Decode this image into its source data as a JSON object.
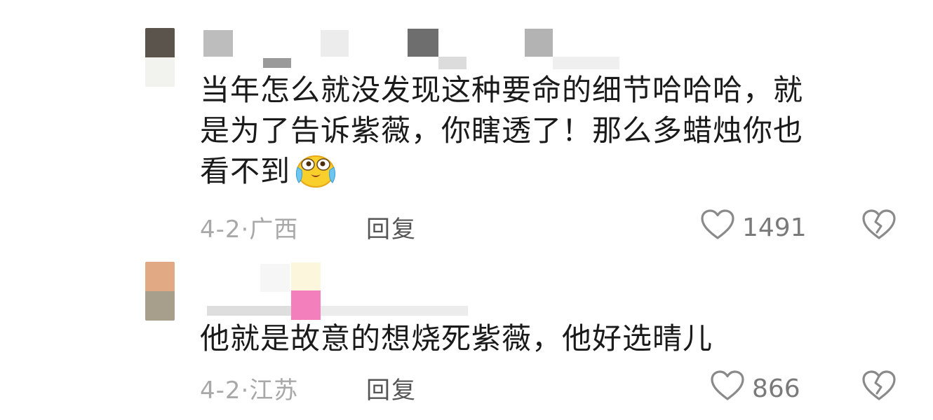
{
  "comments": [
    {
      "text_lines": [
        "当年怎么就没发现这种要命的细节哈哈哈，就",
        "是为了告诉紫薇，你瞎透了！那么多蜡烛你也",
        "看不到"
      ],
      "emoji": "crying-laughing-emoji",
      "date": "4-2·",
      "location": "广西",
      "reply_label": "回复",
      "likes": "1491",
      "avatar_colors": [
        "#5a544c",
        "#f2f2ee"
      ]
    },
    {
      "text_lines": [
        "他就是故意的想烧死紫薇，他好选晴儿"
      ],
      "date": "4-2·",
      "location": "江苏",
      "reply_label": "回复",
      "likes": "866",
      "avatar_colors": [
        "#e2aa84",
        "#a89e8c"
      ]
    }
  ],
  "icons": {
    "like": "heart-outline-icon",
    "dislike": "broken-heart-icon"
  },
  "colors": {
    "text": "#1a1a1a",
    "meta": "#a8a8a8",
    "reply": "#555555",
    "count": "#7a7a7a",
    "icon": "#8a8a8a"
  }
}
